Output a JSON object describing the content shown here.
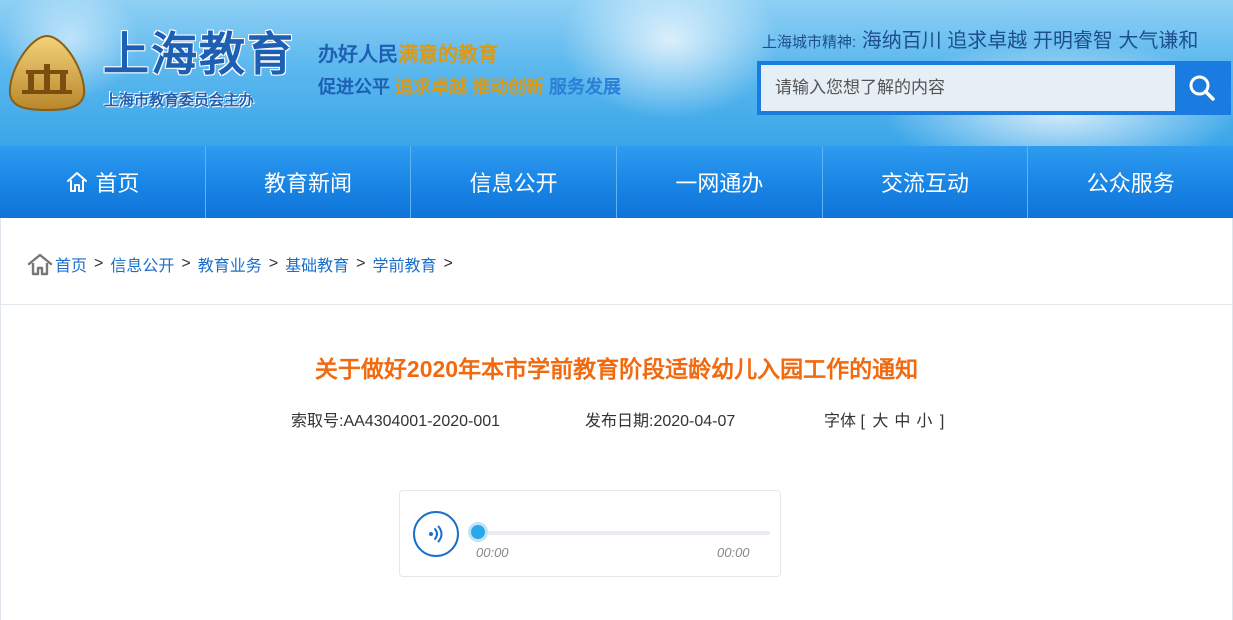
{
  "header": {
    "logo_title": "上海教育",
    "logo_subtitle": "上海市教育委员会主办",
    "slogan_line1": [
      "办好",
      "人民",
      "满意",
      "的",
      "教育"
    ],
    "slogan_line2": [
      "促进公平",
      "追求卓越",
      "推动创新",
      "服务发展"
    ],
    "city_spirit_label": "上海城市精神:",
    "city_spirit_text": "海纳百川 追求卓越 开明睿智 大气谦和",
    "search_placeholder": "请输入您想了解的内容",
    "colors": {
      "brand_blue": "#1d5fb3",
      "gold": "#d99a1a",
      "search_blue": "#1a7be0"
    }
  },
  "nav": {
    "items": [
      {
        "label": "首页",
        "icon": "home-icon"
      },
      {
        "label": "教育新闻"
      },
      {
        "label": "信息公开"
      },
      {
        "label": "一网通办"
      },
      {
        "label": "交流互动"
      },
      {
        "label": "公众服务"
      }
    ]
  },
  "breadcrumb": {
    "items": [
      "首页",
      "信息公开",
      "教育业务",
      "基础教育",
      "学前教育"
    ],
    "separator": ">"
  },
  "article": {
    "title": "关于做好2020年本市学前教育阶段适龄幼儿入园工作的通知",
    "title_color": "#f26a10",
    "index_label": "索取号:",
    "index_value": "AA4304001-2020-001",
    "date_label": "发布日期:",
    "date_value": "2020-04-07",
    "font_label": "字体",
    "font_sizes": [
      "大",
      "中",
      "小"
    ]
  },
  "player": {
    "current_time": "00:00",
    "duration": "00:00",
    "progress": 0
  }
}
